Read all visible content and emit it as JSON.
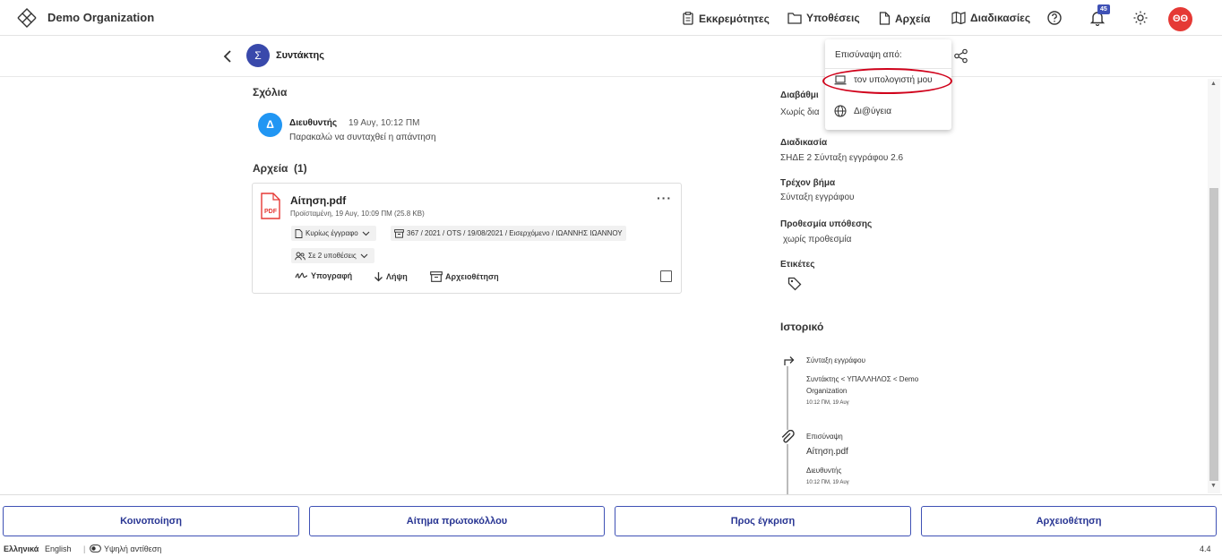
{
  "header": {
    "org_name": "Demo Organization",
    "nav": [
      {
        "label": "Εκκρεμότητες",
        "icon": "clipboard-icon"
      },
      {
        "label": "Υποθέσεις",
        "icon": "folder-icon"
      },
      {
        "label": "Αρχεία",
        "icon": "file-icon"
      },
      {
        "label": "Διαδικασίες",
        "icon": "map-icon"
      }
    ],
    "notification_count": "45",
    "avatar_initials": "ΘΘ"
  },
  "subheader": {
    "avatar_letter": "Σ",
    "title": "Συντάκτης"
  },
  "comments": {
    "title": "Σχόλια",
    "items": [
      {
        "avatar": "Δ",
        "author": "Διευθυντής",
        "time": "19 Αυγ, 10:12 ΠΜ",
        "text": "Παρακαλώ να συνταχθεί η απάντηση"
      }
    ]
  },
  "files": {
    "title": "Αρχεία",
    "count": "(1)",
    "items": [
      {
        "icon_label": "PDF",
        "name": "Αίτηση.pdf",
        "meta": "Προϊσταμένη, 19 Αυγ, 10:09 ΠΜ (25.8 KB)",
        "type_chip": "Κυρίως έγγραφο",
        "protocol_chip": "367 / 2021 / OTS / 19/08/2021 / Εισερχόμενο / ΙΩΑΝΝΗΣ ΙΩΑΝΝΟΥ",
        "cases_chip": "Σε 2 υποθέσεις",
        "actions": [
          "Υπογραφή",
          "Λήψη",
          "Αρχειοθέτηση"
        ]
      }
    ]
  },
  "details": {
    "access_label": "Διαβάθμι",
    "access_value": "Χωρίς δια",
    "procedure_label": "Διαδικασία",
    "procedure_value": "ΣΗΔΕ 2 Σύνταξη εγγράφου 2.6",
    "step_label": "Τρέχον βήμα",
    "step_value": "Σύνταξη εγγράφου",
    "deadline_label": "Προθεσμία υπόθεσης",
    "deadline_value": "χωρίς προθεσμία",
    "tags_label": "Ετικέτες"
  },
  "history": {
    "title": "Ιστορικό",
    "entries": [
      {
        "action": "Σύνταξη εγγράφου",
        "detail": "Συντάκτης < ΥΠΑΛΛΗΛΟΣ < Demo",
        "detail2": "Organization",
        "time": "10:12 ΠΜ, 19 Αυγ"
      },
      {
        "action": "Επισύναψη",
        "file": "Αίτηση.pdf",
        "detail": "Διευθυντής",
        "time": "10:12 ΠΜ, 19 Αυγ"
      }
    ]
  },
  "popup": {
    "title": "Επισύναψη από:",
    "items": [
      "τον υπολογιστή μου",
      "Δι@ύγεια"
    ]
  },
  "bottom_buttons": [
    "Κοινοποίηση",
    "Αίτημα πρωτοκόλλου",
    "Προς έγκριση",
    "Αρχειοθέτηση"
  ],
  "footer": {
    "lang_active": "Ελληνικά",
    "lang_other": "English",
    "contrast": "Υψηλή αντίθεση",
    "version": "4.4"
  },
  "colors": {
    "accent": "#3f51b5",
    "avatar_red": "#e53935",
    "highlight": "#d0021b"
  }
}
